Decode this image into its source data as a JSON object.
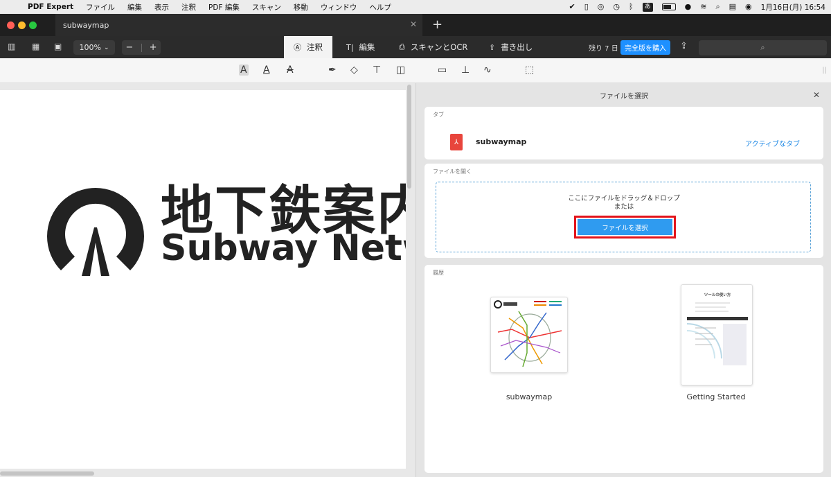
{
  "menubar": {
    "app_name": "PDF Expert",
    "menus": [
      "ファイル",
      "編集",
      "表示",
      "注釈",
      "PDF 編集",
      "スキャン",
      "移動",
      "ウィンドウ",
      "ヘルプ"
    ],
    "ime": "あ",
    "datetime": "1月16日(月)  16:54"
  },
  "tabbar": {
    "doc_tab_title": "subwaymap",
    "close_glyph": "✕",
    "new_tab_glyph": "+"
  },
  "toolbar": {
    "zoom_value": "100%",
    "zoom_minus": "−",
    "zoom_plus": "+",
    "modes": [
      {
        "label": "注釈",
        "icon": "annotate-icon"
      },
      {
        "label": "編集",
        "icon": "edit-text-icon"
      },
      {
        "label": "スキャンとOCR",
        "icon": "scan-ocr-icon"
      },
      {
        "label": "書き出し",
        "icon": "export-icon"
      }
    ],
    "trial_text": "残り 7 日",
    "buy_label": "完全版を購入",
    "search_placeholder": ""
  },
  "annotation_tools": [
    "highlight-text-icon",
    "underline-text-icon",
    "strikethrough-text-icon",
    "pen-icon",
    "eraser-icon",
    "text-box-icon",
    "shapes-icon",
    "comment-icon",
    "stamp-icon",
    "signature-icon",
    "selection-icon"
  ],
  "document": {
    "logo_title": "地下鉄案内",
    "logo_subtitle": "Subway Network"
  },
  "panel": {
    "header_title": "ファイルを選択",
    "tab_section_label": "タブ",
    "tab_file_name": "subwaymap",
    "active_tab_label": "アクティブなタブ",
    "open_section_label": "ファイルを開く",
    "drop_line1": "ここにファイルをドラッグ＆ドロップ",
    "drop_line2": "または",
    "choose_button_label": "ファイルを選択",
    "recent_section_label": "履歴",
    "recent_files": [
      {
        "name": "subwaymap"
      },
      {
        "name": "Getting Started",
        "thumb_title": "ツールの使い方"
      }
    ]
  },
  "colors": {
    "accent_blue": "#1e90ff",
    "highlight_red": "#e3141b",
    "pdf_red": "#e8453c"
  }
}
